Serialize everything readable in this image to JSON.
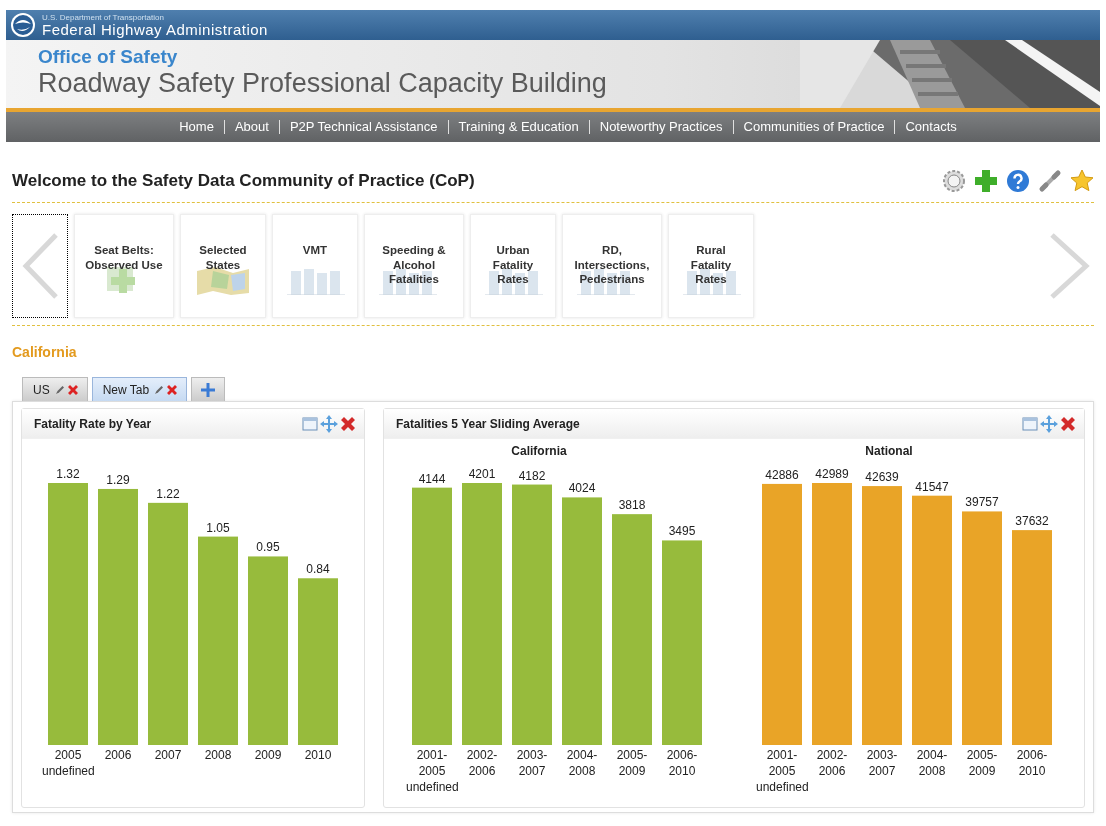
{
  "agency": {
    "department": "U.S. Department of Transportation",
    "name": "Federal Highway Administration"
  },
  "banner": {
    "office": "Office of Safety",
    "title": "Roadway Safety Professional Capacity Building"
  },
  "nav": [
    "Home",
    "About",
    "P2P Technical Assistance",
    "Training & Education",
    "Noteworthy Practices",
    "Communities of Practice",
    "Contacts"
  ],
  "page_title": "Welcome to the Safety Data Community of Practice (CoP)",
  "carousel": [
    {
      "label": "Seat Belts: Observed Use",
      "kind": "plus"
    },
    {
      "label": "Selected States",
      "kind": "map"
    },
    {
      "label": "VMT",
      "kind": "bars"
    },
    {
      "label": "Speeding & Alcohol Fatalities",
      "kind": "bars"
    },
    {
      "label": "Urban Fatality Rates",
      "kind": "bars"
    },
    {
      "label": "RD, Intersections, Pedestrians",
      "kind": "bars"
    },
    {
      "label": "Rural Fatality Rates",
      "kind": "bars"
    }
  ],
  "section_label": "California",
  "tabs": [
    {
      "label": "US",
      "selected": false
    },
    {
      "label": "New Tab",
      "selected": true
    }
  ],
  "panels": [
    {
      "title": "Fatality Rate by Year",
      "charts": [
        {
          "stray_label": "undefined",
          "chart_data": {
            "type": "bar",
            "categories": [
              "2005",
              "2006",
              "2007",
              "2008",
              "2009",
              "2010"
            ],
            "series": [
              {
                "color": "#97bb3c",
                "values": [
                  1.32,
                  1.29,
                  1.22,
                  1.05,
                  0.95,
                  0.84
                ]
              }
            ],
            "ylim": [
              0,
              1.32
            ],
            "data_labels": true
          }
        }
      ]
    },
    {
      "title": "Fatalities 5 Year Sliding Average",
      "charts": [
        {
          "stray_label": "undefined",
          "chart_data": {
            "type": "bar",
            "title": "California",
            "categories": [
              "2001-2005",
              "2002-2006",
              "2003-2007",
              "2004-2008",
              "2005-2009",
              "2006-2010"
            ],
            "series": [
              {
                "color": "#97bb3c",
                "values": [
                  4144,
                  4201,
                  4182,
                  4024,
                  3818,
                  3495
                ]
              }
            ],
            "ylim": [
              980,
              4201
            ],
            "data_labels": true
          }
        },
        {
          "stray_label": "undefined",
          "chart_data": {
            "type": "bar",
            "title": "National",
            "categories": [
              "2001-2005",
              "2002-2006",
              "2003-2007",
              "2004-2008",
              "2005-2009",
              "2006-2010"
            ],
            "series": [
              {
                "color": "#e9a427",
                "values": [
                  42886,
                  42989,
                  42639,
                  41547,
                  39757,
                  37632
                ]
              }
            ],
            "ylim": [
              13200,
              42989
            ],
            "data_labels": true
          }
        }
      ]
    }
  ]
}
